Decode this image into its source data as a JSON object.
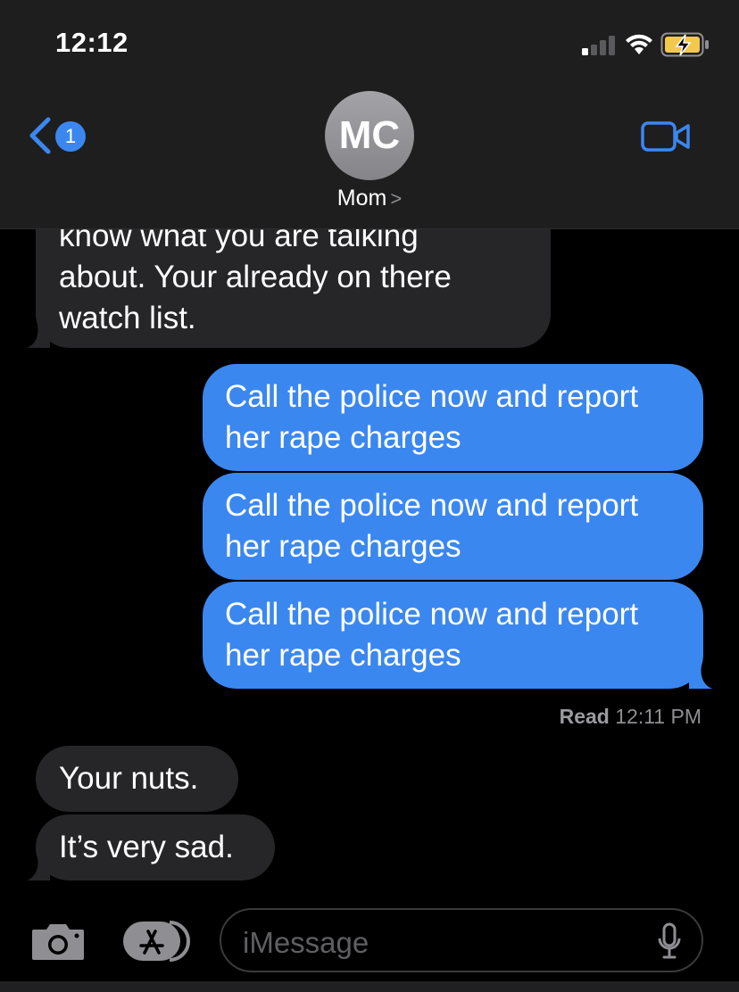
{
  "status_bar": {
    "time": "12:12"
  },
  "header": {
    "back_badge": "1",
    "avatar_initials": "MC",
    "contact_name": "Mom",
    "contact_chevron": ">"
  },
  "messages": [
    {
      "direction": "received",
      "text": "know what you are talking\nabout. Your already on there\nwatch list."
    },
    {
      "direction": "sent",
      "text": "Call the police now and report\nher rape charges"
    },
    {
      "direction": "sent",
      "text": "Call the police now and report\nher rape charges"
    },
    {
      "direction": "sent",
      "text": "Call the police now and report\nher rape charges"
    },
    {
      "direction": "received",
      "text": "Your nuts."
    },
    {
      "direction": "received",
      "text": "It’s very sad."
    }
  ],
  "read_receipt": {
    "label": "Read",
    "time": "12:11 PM"
  },
  "input": {
    "placeholder": "iMessage"
  },
  "colors": {
    "sent_bubble": "#3b87f0",
    "received_bubble": "#262628",
    "accent": "#3b87f0"
  }
}
